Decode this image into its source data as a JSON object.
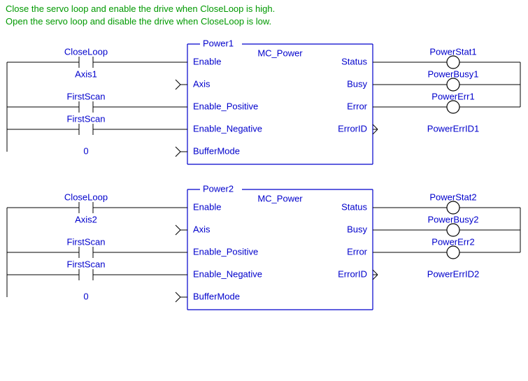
{
  "comment": {
    "line1": "Close the servo loop and enable the drive when CloseLoop is high.",
    "line2": "Open the servo loop and disable the drive when CloseLoop is low."
  },
  "blocks": [
    {
      "instance": "Power1",
      "type": "MC_Power",
      "inputs": {
        "enable_contact": "CloseLoop",
        "axis": "Axis1",
        "pos_contact": "FirstScan",
        "neg_contact": "FirstScan",
        "buffermode_val": "0"
      },
      "ports_in": {
        "p1": "Enable",
        "p2": "Axis",
        "p3": "Enable_Positive",
        "p4": "Enable_Negative",
        "p5": "BufferMode"
      },
      "ports_out": {
        "o1": "Status",
        "o2": "Busy",
        "o3": "Error",
        "o4": "ErrorID"
      },
      "outputs": {
        "status": "PowerStat1",
        "busy": "PowerBusy1",
        "error": "PowerErr1",
        "errorid": "PowerErrID1"
      }
    },
    {
      "instance": "Power2",
      "type": "MC_Power",
      "inputs": {
        "enable_contact": "CloseLoop",
        "axis": "Axis2",
        "pos_contact": "FirstScan",
        "neg_contact": "FirstScan",
        "buffermode_val": "0"
      },
      "ports_in": {
        "p1": "Enable",
        "p2": "Axis",
        "p3": "Enable_Positive",
        "p4": "Enable_Negative",
        "p5": "BufferMode"
      },
      "ports_out": {
        "o1": "Status",
        "o2": "Busy",
        "o3": "Error",
        "o4": "ErrorID"
      },
      "outputs": {
        "status": "PowerStat2",
        "busy": "PowerBusy2",
        "error": "PowerErr2",
        "errorid": "PowerErrID2"
      }
    }
  ]
}
